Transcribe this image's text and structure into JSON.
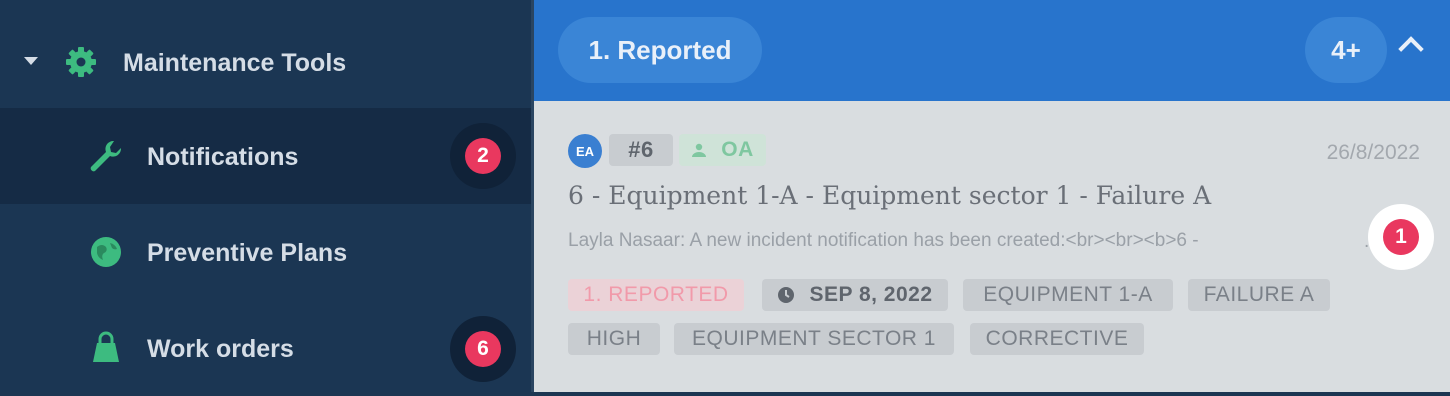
{
  "sidebar": {
    "section_title": "Maintenance Tools",
    "items": [
      {
        "label": "Notifications",
        "icon": "wrench-icon",
        "badge": "2",
        "active": true
      },
      {
        "label": "Preventive Plans",
        "icon": "globe-icon"
      },
      {
        "label": "Work orders",
        "icon": "bag-icon",
        "badge": "6"
      }
    ]
  },
  "column": {
    "title": "1. Reported",
    "count": "4+",
    "collapse_icon": "chevron-up-icon"
  },
  "card": {
    "avatar": "EA",
    "number": "#6",
    "assignee": "OA",
    "date": "26/8/2022",
    "title": "6 - Equipment 1-A - Equipment sector 1 - Failure A",
    "excerpt": "Layla Nasaar: A new incident notification has been created:<br><br><b>6 -",
    "ellipsis": "..",
    "indicator_badge": "1",
    "tags": {
      "status": "1. REPORTED",
      "due": "SEP 8, 2022",
      "equipment": "EQUIPMENT 1-A",
      "failure": "FAILURE A",
      "priority": "HIGH",
      "sector": "EQUIPMENT SECTOR 1",
      "type": "CORRECTIVE"
    }
  },
  "colors": {
    "sidebar_bg": "#1b3653",
    "sidebar_active": "#152b45",
    "accent_green": "#3dbb80",
    "header_blue": "#2874cc",
    "badge_red": "#e9385f"
  }
}
